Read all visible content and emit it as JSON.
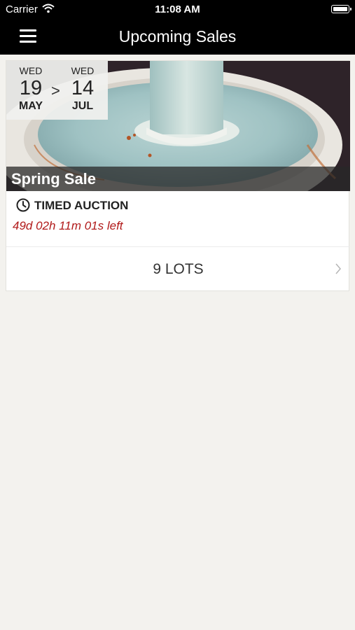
{
  "status_bar": {
    "carrier": "Carrier",
    "time": "11:08 AM"
  },
  "nav": {
    "title": "Upcoming Sales"
  },
  "sale": {
    "start": {
      "dow": "WED",
      "day": "19",
      "month": "MAY"
    },
    "separator": ">",
    "end": {
      "dow": "WED",
      "day": "14",
      "month": "JUL"
    },
    "title": "Spring Sale",
    "auction_type": "TIMED AUCTION",
    "countdown": "49d 02h 11m 01s left",
    "lots_label": "9 LOTS"
  },
  "colors": {
    "countdown": "#b11a1a",
    "background": "#f3f2ee",
    "nav": "#000000"
  }
}
